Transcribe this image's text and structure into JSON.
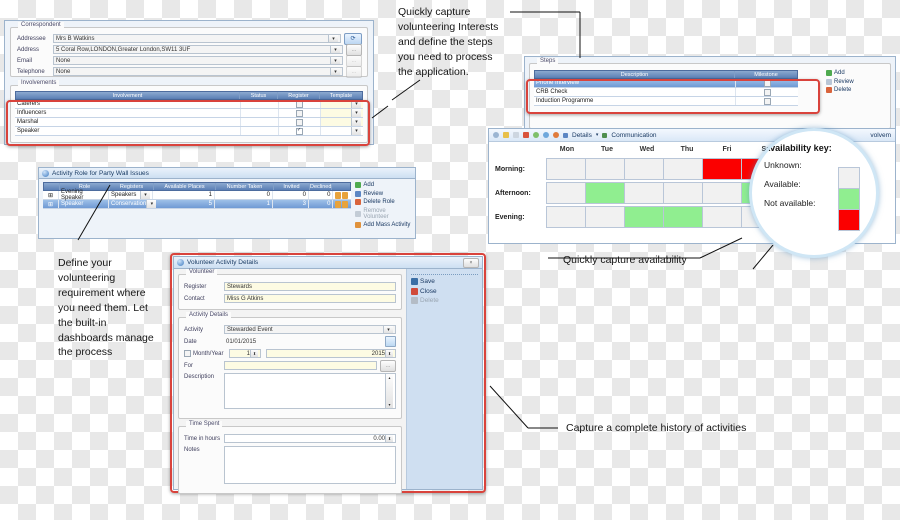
{
  "annotations": {
    "top_right": "Quickly capture volunteering Interests and define the steps you need to process the application.",
    "left": "Define your volunteering requirement where you need them. Let the built-in dashboards manage the process",
    "availability": "Quickly capture availability",
    "history": "Capture  a complete history of activities"
  },
  "correspondent_panel": {
    "group_title": "Correspondent",
    "fields": [
      {
        "label": "Addressee",
        "value": "Mrs B Watkins",
        "button": "refresh-icon"
      },
      {
        "label": "Address",
        "value": "5 Coral Row,LONDON,Greater London,SW11 3UF",
        "button": "..."
      },
      {
        "label": "Email",
        "value": "None",
        "button": "..."
      },
      {
        "label": "Telephone",
        "value": "None",
        "button": "..."
      }
    ],
    "involvements": {
      "group_title": "Involvements",
      "columns": [
        "Involvement",
        "Status",
        "Register",
        "Template"
      ],
      "rows": [
        {
          "involvement": "Caterers",
          "status": "",
          "register": false,
          "template": ""
        },
        {
          "involvement": "Influencers",
          "status": "",
          "register": false,
          "template": ""
        },
        {
          "involvement": "Marshal",
          "status": "",
          "register": false,
          "template": ""
        },
        {
          "involvement": "Speaker",
          "status": "",
          "register": true,
          "template": ""
        }
      ]
    }
  },
  "steps_panel": {
    "group_title": "Steps",
    "columns": [
      "Description",
      "Milestone"
    ],
    "rows": [
      {
        "description": "Phone Interview",
        "milestone": false,
        "selected": true
      },
      {
        "description": "CRB Check",
        "milestone": false,
        "selected": false
      },
      {
        "description": "Induction Programme",
        "milestone": false,
        "selected": false
      }
    ],
    "buttons": [
      {
        "label": "Add",
        "icon": "add-icon",
        "color": "#4faa4f",
        "disabled": false
      },
      {
        "label": "Review",
        "icon": "review-icon",
        "color": "#b9c6d6",
        "disabled": false
      },
      {
        "label": "Delete",
        "icon": "delete-icon",
        "color": "#d9643c",
        "disabled": false
      }
    ]
  },
  "activity_role_panel": {
    "title": "Activity Role for Party Wall Issues",
    "columns": [
      "Role",
      "Registers",
      "Available Places",
      "Number Taken",
      "Invited",
      "Declined"
    ],
    "rows": [
      {
        "role": "Evening Speaker",
        "registers": "Speakers",
        "available_places": "1",
        "number_taken": "0",
        "invited": "0",
        "declined": "0",
        "selected": false
      },
      {
        "role": "Speaker",
        "registers": "Conservation",
        "available_places": "5",
        "number_taken": "1",
        "invited": "3",
        "declined": "0",
        "selected": true
      }
    ],
    "buttons": [
      {
        "label": "Add",
        "color": "#4faa4f",
        "disabled": false
      },
      {
        "label": "Review",
        "color": "#5b86c4",
        "disabled": false
      },
      {
        "label": "Delete Role",
        "color": "#d9643c",
        "disabled": false
      },
      {
        "label": "Remove Volunteer",
        "color": "#c3ccd6",
        "disabled": true
      },
      {
        "label": "Add Mass Activity",
        "color": "#e0923c",
        "disabled": false
      }
    ]
  },
  "availability_panel": {
    "toolbar": {
      "details_label": "Details",
      "communications_label": "Communication",
      "involvement_label": "volvem"
    },
    "days": [
      "Mon",
      "Tue",
      "Wed",
      "Thu",
      "Fri",
      "Sat"
    ],
    "periods": [
      "Morning:",
      "Afternoon:",
      "Evening:"
    ],
    "grid": [
      [
        "unknown",
        "unknown",
        "unknown",
        "unknown",
        "notavailable",
        "notavailable"
      ],
      [
        "unknown",
        "available",
        "unknown",
        "unknown",
        "unknown",
        "available"
      ],
      [
        "unknown",
        "unknown",
        "available",
        "available",
        "unknown",
        "unknown"
      ]
    ],
    "colors": {
      "unknown": "#f1f1f1",
      "available": "#90ee90",
      "notavailable": "#fb0000"
    },
    "key": {
      "title": "Availability key:",
      "items": [
        {
          "label": "Unknown:",
          "state": "unknown"
        },
        {
          "label": "Available:",
          "state": "available"
        },
        {
          "label": "Not available:",
          "state": "notavailable"
        }
      ]
    }
  },
  "volunteer_dialog": {
    "title": "Volunteer Activity Details",
    "close_label": "×",
    "volunteer_group": "Volunteer",
    "volunteer_fields": [
      {
        "label": "Register",
        "value": "Stewards"
      },
      {
        "label": "Contact",
        "value": "Miss G Atkins"
      }
    ],
    "activity_group": "Activity Details",
    "activity": {
      "label": "Activity",
      "value": "Stewarded Event"
    },
    "date": {
      "label": "Date",
      "value": "01/01/2015"
    },
    "month_year": {
      "label": "Month/Year",
      "month": "1",
      "year": "2015",
      "checked": false
    },
    "for_field": {
      "label": "For",
      "value": ""
    },
    "description": {
      "label": "Description",
      "value": ""
    },
    "time_group": "Time Spent",
    "time_hours": {
      "label": "Time in hours",
      "value": "0.00"
    },
    "notes": {
      "label": "Notes",
      "value": ""
    },
    "buttons": [
      {
        "label": "Save",
        "icon": "save-icon",
        "color": "#3a6ea5",
        "disabled": false
      },
      {
        "label": "Close",
        "icon": "close-icon",
        "color": "#d04a3a",
        "disabled": false
      },
      {
        "label": "Delete",
        "icon": "delete-icon",
        "color": "#b4bcc6",
        "disabled": true
      }
    ]
  }
}
